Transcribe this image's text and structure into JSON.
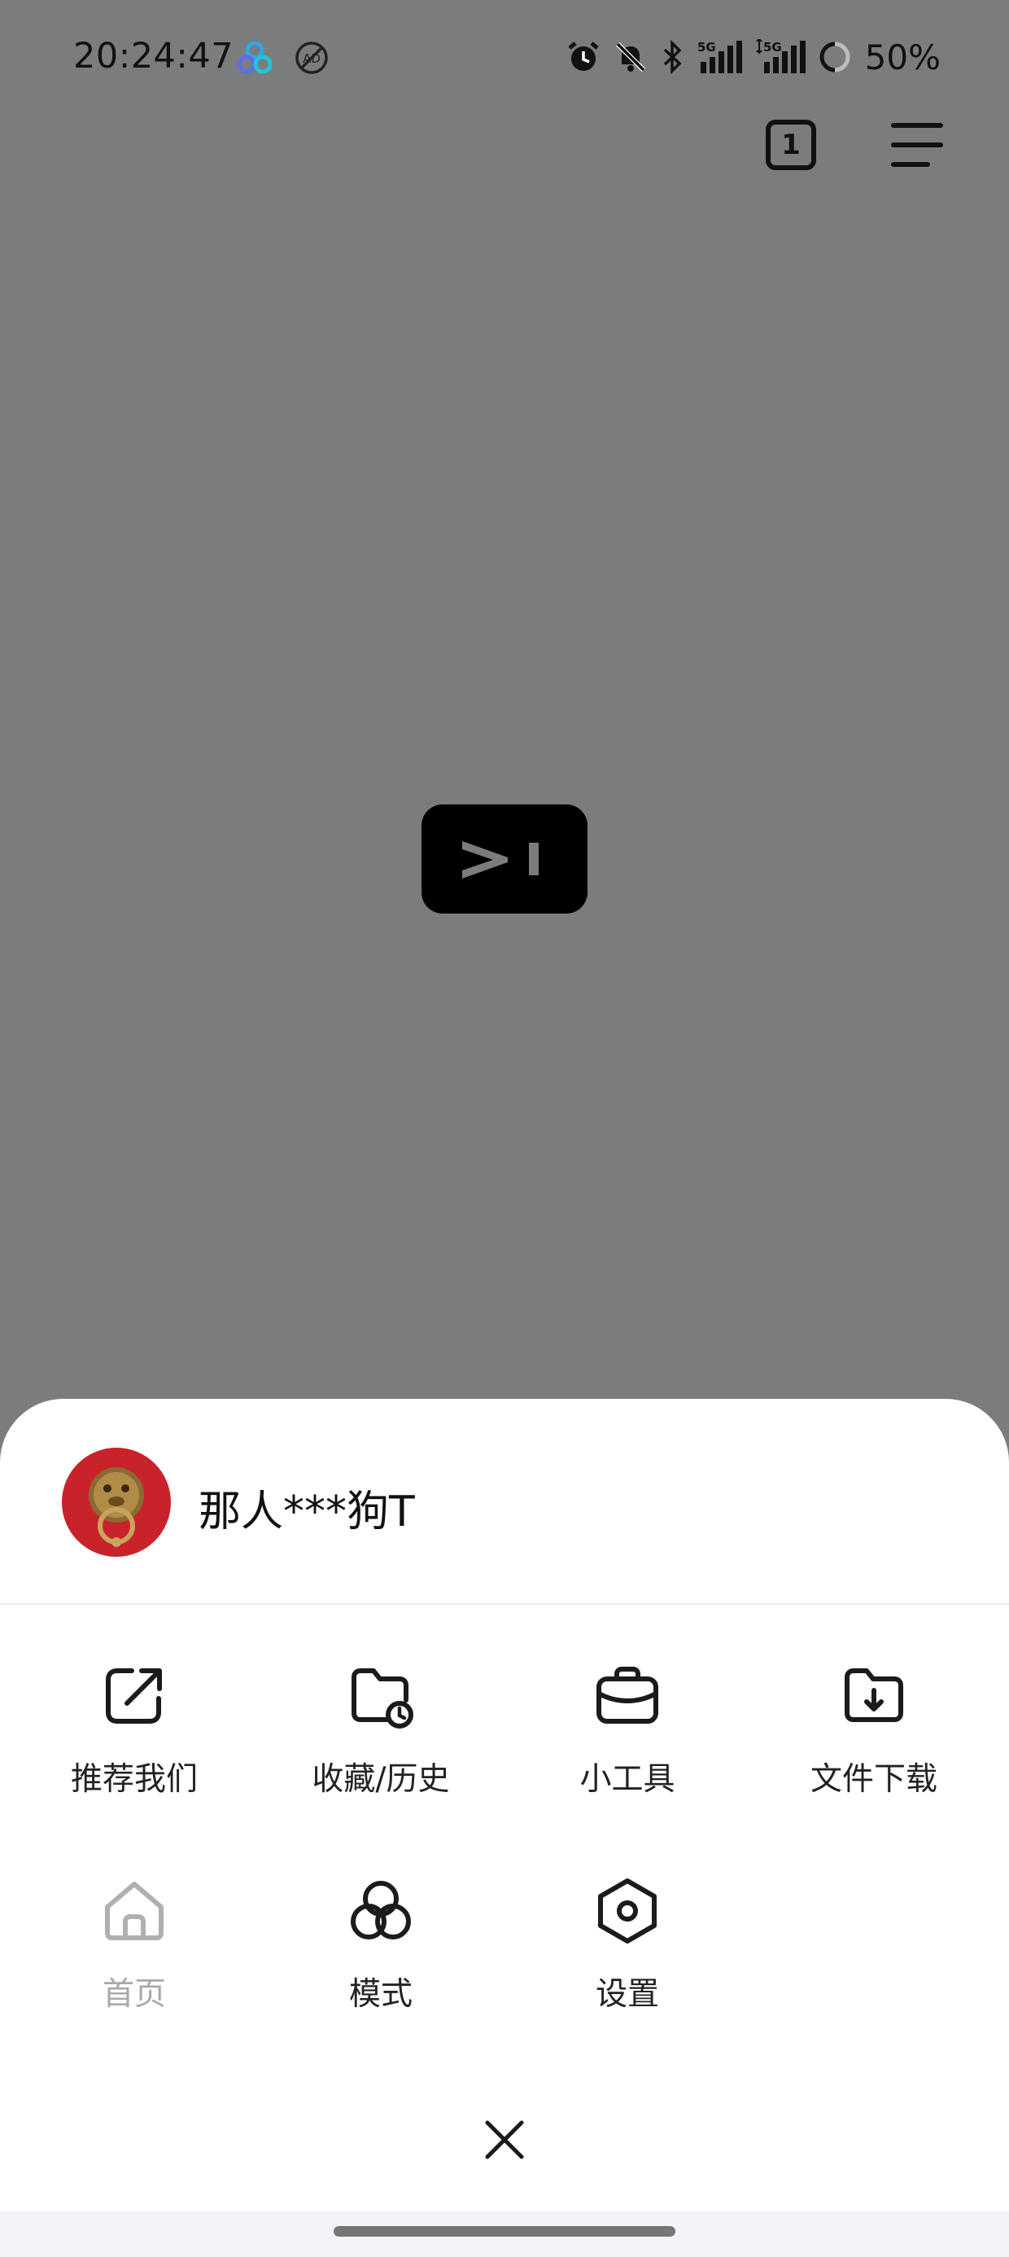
{
  "status_bar": {
    "time": "20:24:47",
    "battery": "50%",
    "network_1": "5G",
    "network_2": "5G"
  },
  "top_bar": {
    "tab_count": "1"
  },
  "profile": {
    "username": "那人***狗T"
  },
  "menu": {
    "items": [
      {
        "label": "推荐我们",
        "icon": "share-icon",
        "enabled": true
      },
      {
        "label": "收藏/历史",
        "icon": "folder-clock-icon",
        "enabled": true
      },
      {
        "label": "小工具",
        "icon": "briefcase-icon",
        "enabled": true
      },
      {
        "label": "文件下载",
        "icon": "folder-download-icon",
        "enabled": true
      },
      {
        "label": "首页",
        "icon": "home-icon",
        "enabled": false
      },
      {
        "label": "模式",
        "icon": "circles-mode-icon",
        "enabled": true
      },
      {
        "label": "设置",
        "icon": "hexagon-settings-icon",
        "enabled": true
      }
    ]
  },
  "colors": {
    "overlay_background": "#7b7c7e",
    "sheet_background": "#ffffff",
    "avatar_red": "#c8232a",
    "disabled_text": "#a9a9a9"
  }
}
